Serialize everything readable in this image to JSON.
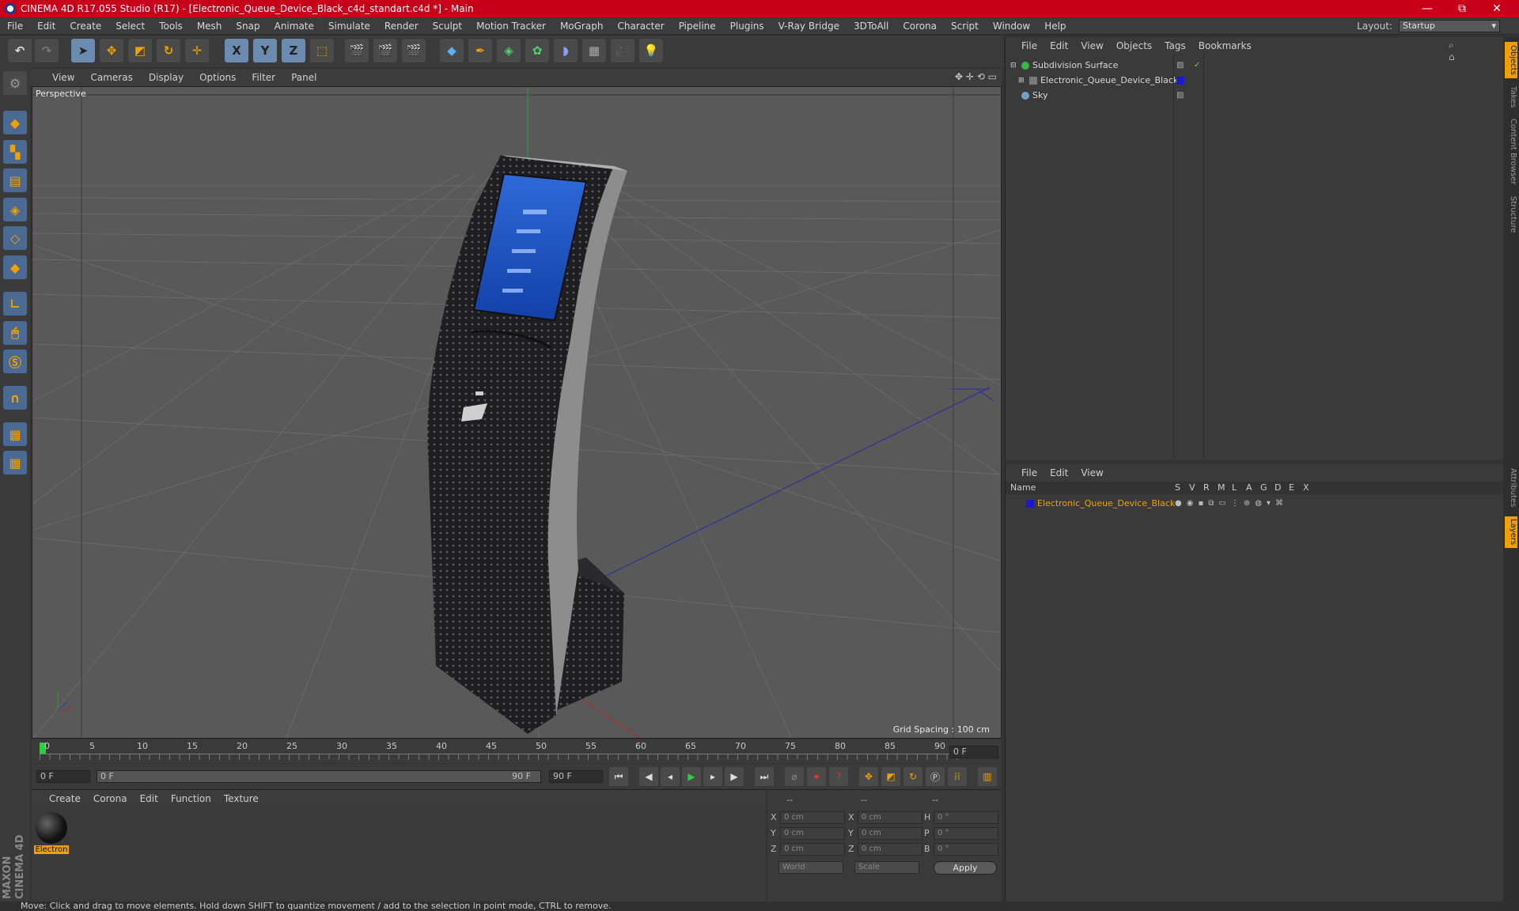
{
  "window": {
    "title": "CINEMA 4D R17.055 Studio (R17) - [Electronic_Queue_Device_Black_c4d_standart.c4d *] - Main",
    "controls": [
      "—",
      "⧉",
      "✕"
    ]
  },
  "menubar": {
    "items": [
      "File",
      "Edit",
      "Create",
      "Select",
      "Tools",
      "Mesh",
      "Snap",
      "Animate",
      "Simulate",
      "Render",
      "Sculpt",
      "Motion Tracker",
      "MoGraph",
      "Character",
      "Pipeline",
      "Plugins",
      "V-Ray Bridge",
      "3DToAll",
      "Corona",
      "Script",
      "Window",
      "Help"
    ],
    "layout_label": "Layout:",
    "layout_value": "Startup"
  },
  "toolbar": {
    "axis_x": "X",
    "axis_y": "Y",
    "axis_z": "Z"
  },
  "viewport": {
    "menu": [
      "View",
      "Cameras",
      "Display",
      "Options",
      "Filter",
      "Panel"
    ],
    "label": "Perspective",
    "grid_spacing": "Grid Spacing : 100 cm"
  },
  "timeline": {
    "ticks": [
      "0",
      "5",
      "10",
      "15",
      "20",
      "25",
      "30",
      "35",
      "40",
      "45",
      "50",
      "55",
      "60",
      "65",
      "70",
      "75",
      "80",
      "85",
      "90"
    ],
    "current_frame": "0 F"
  },
  "transport": {
    "start": "0 F",
    "slider_start": "0 F",
    "slider_end": "90 F",
    "end": "90 F"
  },
  "material_panel": {
    "menu": [
      "Create",
      "Corona",
      "Edit",
      "Function",
      "Texture"
    ],
    "material_name": "Electron"
  },
  "coord_panel": {
    "header": [
      "--",
      "--",
      "--"
    ],
    "rows": [
      {
        "a": "X",
        "av": "0 cm",
        "b": "X",
        "bv": "0 cm",
        "c": "H",
        "cv": "0 °"
      },
      {
        "a": "Y",
        "av": "0 cm",
        "b": "Y",
        "bv": "0 cm",
        "c": "P",
        "cv": "0 °"
      },
      {
        "a": "Z",
        "av": "0 cm",
        "b": "Z",
        "bv": "0 cm",
        "c": "B",
        "cv": "0 °"
      }
    ],
    "space": "World",
    "mode": "Scale",
    "apply": "Apply"
  },
  "object_manager": {
    "menu": [
      "File",
      "Edit",
      "View",
      "Objects",
      "Tags",
      "Bookmarks"
    ],
    "objects": [
      {
        "name": "Subdivision Surface",
        "color": "#3ab54a"
      },
      {
        "name": "Electronic_Queue_Device_Black",
        "color": "#1a1acc"
      },
      {
        "name": "Sky",
        "color": "#6fa0c8"
      }
    ]
  },
  "layer_manager": {
    "menu": [
      "File",
      "Edit",
      "View"
    ],
    "header_name": "Name",
    "header_cols": [
      "S",
      "V",
      "R",
      "M",
      "L",
      "A",
      "G",
      "D",
      "E",
      "X"
    ],
    "layers": [
      {
        "name": "Electronic_Queue_Device_Black",
        "color": "#1a1acc"
      }
    ]
  },
  "right_tabs": [
    "Objects",
    "Takes",
    "Content Browser",
    "Structure",
    "Attributes",
    "Layers"
  ],
  "brand": "MAXON CINEMA 4D",
  "status": "Move: Click and drag to move elements. Hold down SHIFT to quantize movement / add to the selection in point mode, CTRL to remove."
}
